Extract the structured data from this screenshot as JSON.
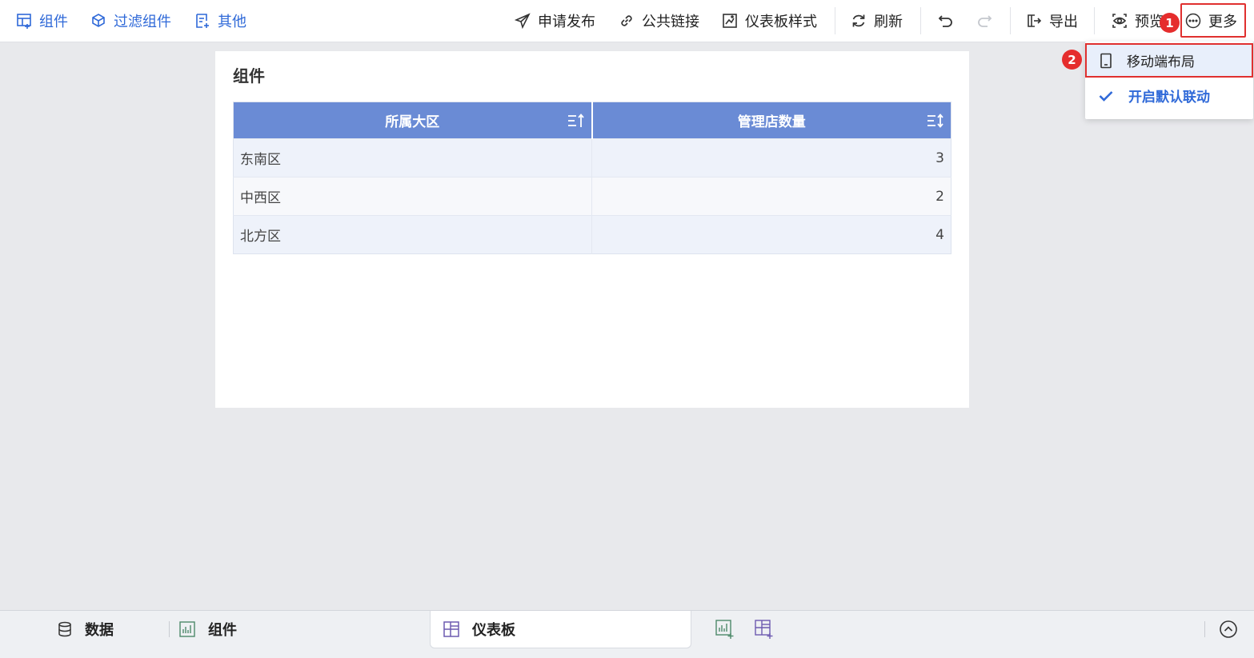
{
  "toolbar": {
    "left": [
      {
        "label": "组件",
        "icon": "add-component-icon"
      },
      {
        "label": "过滤组件",
        "icon": "filter-component-icon"
      },
      {
        "label": "其他",
        "icon": "other-icon"
      }
    ],
    "publish": "申请发布",
    "public_link": "公共链接",
    "dashboard_style": "仪表板样式",
    "refresh": "刷新",
    "export": "导出",
    "preview": "预览",
    "more": "更多"
  },
  "annotations": {
    "step1": "1",
    "step2": "2"
  },
  "dropdown": {
    "mobile_layout": "移动端布局",
    "default_linkage": "开启默认联动",
    "default_linkage_checked": true
  },
  "widget": {
    "title": "组件",
    "columns": [
      "所属大区",
      "管理店数量"
    ],
    "rows": [
      {
        "region": "东南区",
        "count": "3"
      },
      {
        "region": "中西区",
        "count": "2"
      },
      {
        "region": "北方区",
        "count": "4"
      }
    ]
  },
  "bottom": {
    "data": "数据",
    "component": "组件",
    "dashboard": "仪表板"
  },
  "colors": {
    "accent": "#2f69d8",
    "header_bg": "#6a8bd5",
    "highlight": "#e0302f"
  }
}
